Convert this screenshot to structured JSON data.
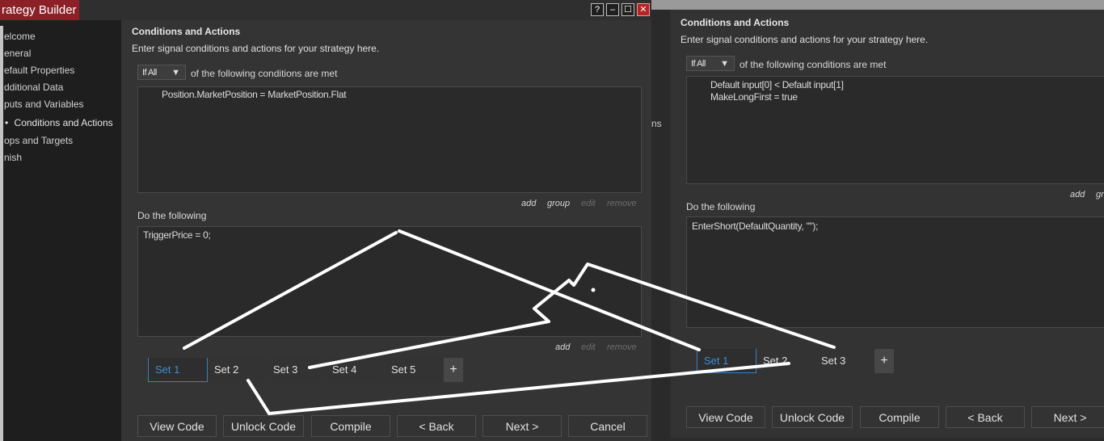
{
  "front": {
    "title": "rategy Builder",
    "window_buttons": [
      "?",
      "–",
      "☐",
      "✕"
    ],
    "sidebar": [
      {
        "label": "elcome"
      },
      {
        "label": "eneral"
      },
      {
        "label": "efault Properties"
      },
      {
        "label": "dditional Data"
      },
      {
        "label": "puts and Variables"
      },
      {
        "label": "Conditions and Actions",
        "active_marker": "•"
      },
      {
        "label": "ops and Targets"
      },
      {
        "label": "nish"
      }
    ],
    "section_title": "Conditions and Actions",
    "section_desc": "Enter signal conditions and actions for your strategy here.",
    "condition_mode": "If All",
    "condition_suffix": "of the following conditions are met",
    "conditions": [
      "Position.MarketPosition = MarketPosition.Flat"
    ],
    "cond_links": {
      "add": "add",
      "group": "group",
      "edit": "edit",
      "remove": "remove"
    },
    "do_following": "Do the following",
    "actions": [
      "TriggerPrice = 0;"
    ],
    "action_links": {
      "add": "add",
      "edit": "edit",
      "remove": "remove"
    },
    "sets": [
      "Set 1",
      "Set 2",
      "Set 3",
      "Set 4",
      "Set 5"
    ],
    "plus": "+",
    "buttons": [
      "View Code",
      "Unlock Code",
      "Compile",
      "< Back",
      "Next >",
      "Cancel"
    ]
  },
  "back": {
    "ns_fragment": "ns",
    "section_title": "Conditions and Actions",
    "section_desc": "Enter signal conditions and actions for your strategy here.",
    "condition_mode": "If All",
    "condition_suffix": "of the following conditions are met",
    "conditions": [
      "Default input[0] < Default input[1]",
      "MakeLongFirst = true"
    ],
    "cond_links": {
      "add": "add",
      "group": "gr"
    },
    "do_following": "Do the following",
    "actions": [
      "EnterShort(DefaultQuantity, \"\");"
    ],
    "sets": [
      "Set 1",
      "Set 2",
      "Set 3"
    ],
    "plus": "+",
    "buttons": [
      "View Code",
      "Unlock Code",
      "Compile",
      "< Back",
      "Next >"
    ]
  },
  "colors": {
    "accent_tab": "#3a8fd6",
    "title_badge": "#8b2127",
    "close_button": "#b52323",
    "annotation_stroke": "#ffffff"
  }
}
